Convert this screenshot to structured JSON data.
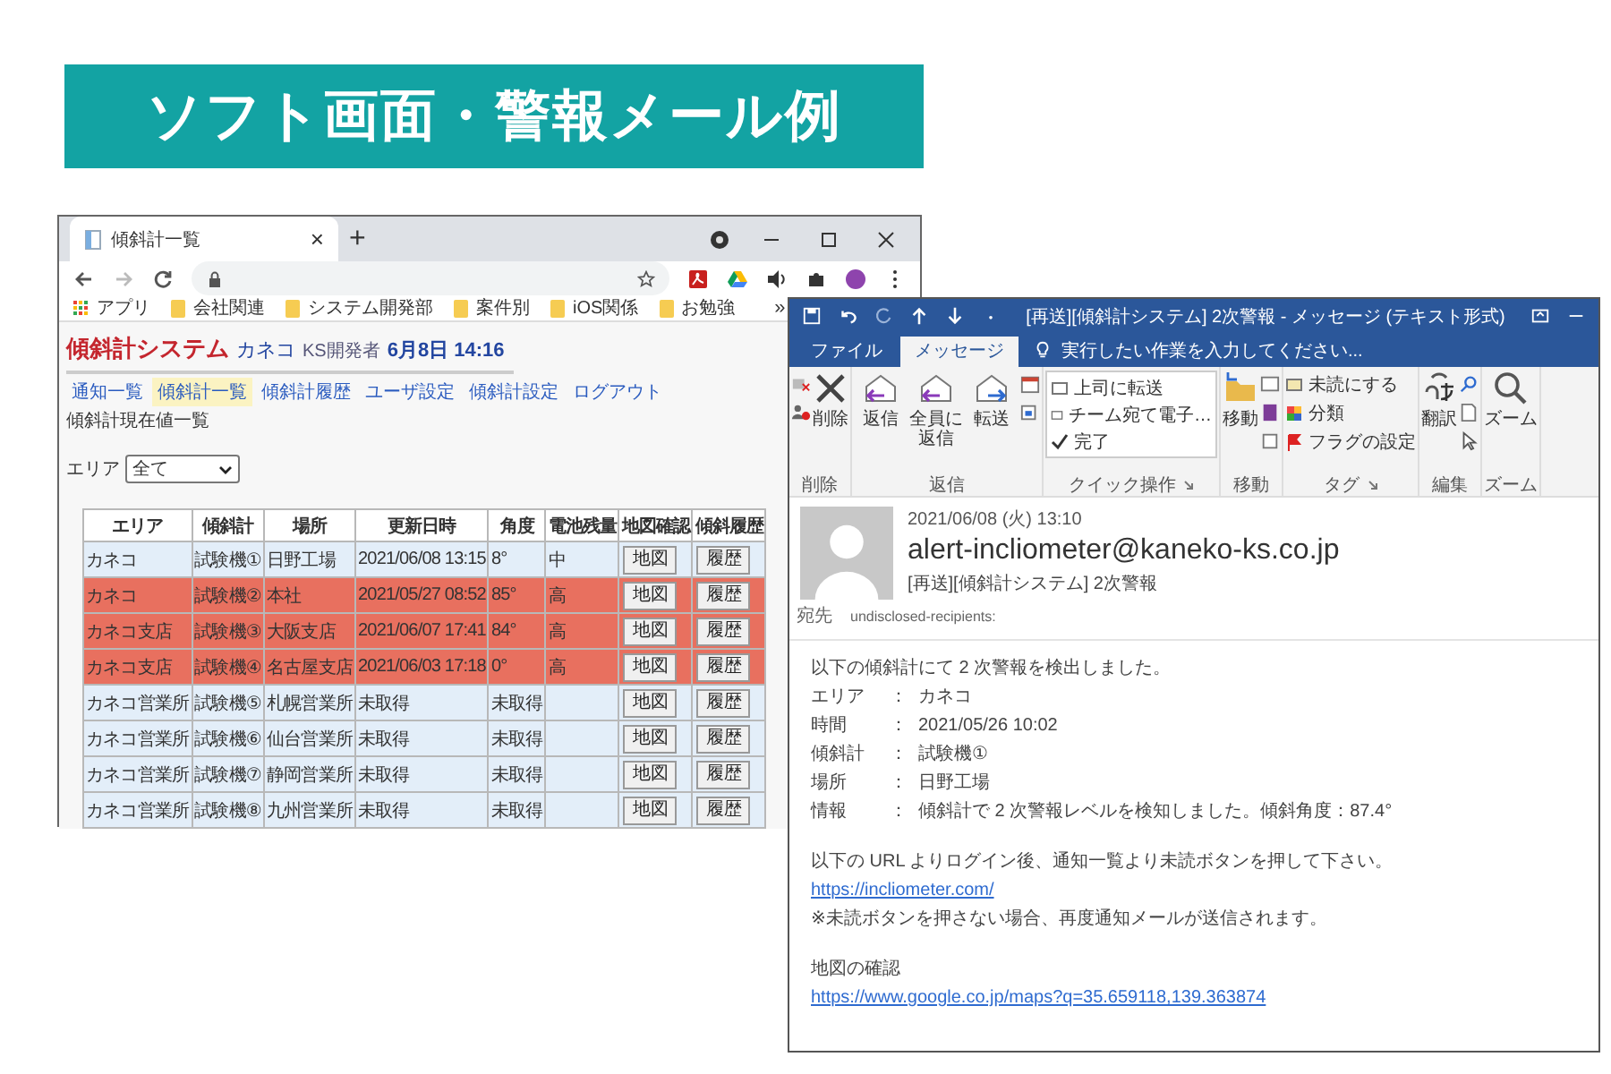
{
  "banner": {
    "title": "ソフト画面・警報メール例"
  },
  "browser": {
    "tab": {
      "title": "傾斜計一覧",
      "close": "×"
    },
    "new_tab": "+",
    "bookmarks": [
      {
        "label": "アプリ",
        "kind": "apps"
      },
      {
        "label": "会社関連",
        "kind": "folder"
      },
      {
        "label": "システム開発部",
        "kind": "folder"
      },
      {
        "label": "案件別",
        "kind": "folder"
      },
      {
        "label": "iOS関係",
        "kind": "folder"
      },
      {
        "label": "お勉強",
        "kind": "folder"
      }
    ],
    "bookmarks_more": "»",
    "app": {
      "title": "傾斜計システム",
      "company": "カネコ",
      "user": "KS開発者",
      "datetime": "6月8日 14:16",
      "nav": [
        {
          "label": "通知一覧",
          "selected": false
        },
        {
          "label": "傾斜計一覧",
          "selected": true
        },
        {
          "label": "傾斜計履歴",
          "selected": false
        },
        {
          "label": "ユーザ設定",
          "selected": false
        },
        {
          "label": "傾斜計設定",
          "selected": false
        },
        {
          "label": "ログアウト",
          "selected": false
        }
      ],
      "page_title": "傾斜計現在値一覧",
      "filter": {
        "label": "エリア",
        "value": "全て"
      },
      "table": {
        "columns": [
          "エリア",
          "傾斜計",
          "場所",
          "更新日時",
          "角度",
          "電池残量",
          "地図確認",
          "傾斜履歴"
        ],
        "rows": [
          {
            "area": "カネコ",
            "meter": "試験機①",
            "place": "日野工場",
            "updated": "2021/06/08 13:15",
            "angle": "8°",
            "battery": "中",
            "map": "地図",
            "history": "履歴",
            "alert": false
          },
          {
            "area": "カネコ",
            "meter": "試験機②",
            "place": "本社",
            "updated": "2021/05/27 08:52",
            "angle": "85°",
            "battery": "高",
            "map": "地図",
            "history": "履歴",
            "alert": true
          },
          {
            "area": "カネコ支店",
            "meter": "試験機③",
            "place": "大阪支店",
            "updated": "2021/06/07 17:41",
            "angle": "84°",
            "battery": "高",
            "map": "地図",
            "history": "履歴",
            "alert": true
          },
          {
            "area": "カネコ支店",
            "meter": "試験機④",
            "place": "名古屋支店",
            "updated": "2021/06/03 17:18",
            "angle": "0°",
            "battery": "高",
            "map": "地図",
            "history": "履歴",
            "alert": true
          },
          {
            "area": "カネコ営業所",
            "meter": "試験機⑤",
            "place": "札幌営業所",
            "updated": "未取得",
            "angle": "未取得",
            "map": "地図",
            "history": "履歴",
            "alert": false
          },
          {
            "area": "カネコ営業所",
            "meter": "試験機⑥",
            "place": "仙台営業所",
            "updated": "未取得",
            "angle": "未取得",
            "map": "地図",
            "history": "履歴",
            "alert": false
          },
          {
            "area": "カネコ営業所",
            "meter": "試験機⑦",
            "place": "静岡営業所",
            "updated": "未取得",
            "angle": "未取得",
            "map": "地図",
            "history": "履歴",
            "alert": false
          },
          {
            "area": "カネコ営業所",
            "meter": "試験機⑧",
            "place": "九州営業所",
            "updated": "未取得",
            "angle": "未取得",
            "map": "地図",
            "history": "履歴",
            "alert": false
          }
        ]
      }
    }
  },
  "mail": {
    "title": "[再送][傾斜計システム] 2次警報 - メッセージ (テキスト形式)",
    "tabs": [
      {
        "label": "ファイル",
        "selected": false
      },
      {
        "label": "メッセージ",
        "selected": true
      }
    ],
    "tell_me": "実行したい作業を入力してください...",
    "ribbon": [
      {
        "kind": "delete",
        "name": "削除",
        "buttons": [
          "削除"
        ]
      },
      {
        "kind": "respond",
        "name": "返信",
        "buttons": [
          "返信",
          "全員に返信",
          "転送"
        ]
      },
      {
        "kind": "quick",
        "name": "クイック操作",
        "items": [
          "上司に転送",
          "チーム宛て電子…",
          "完了"
        ],
        "launcher": true
      },
      {
        "kind": "move",
        "name": "移動",
        "buttons": [
          "移動"
        ]
      },
      {
        "kind": "tags",
        "name": "タグ",
        "items": [
          "未読にする",
          "分類",
          "フラグの設定"
        ],
        "launcher": true
      },
      {
        "kind": "editing",
        "name": "編集",
        "buttons": [
          "翻訳"
        ]
      },
      {
        "kind": "zoom",
        "name": "ズーム",
        "buttons": [
          "ズーム"
        ]
      }
    ],
    "header": {
      "sent": "2021/06/08 (火) 13:10",
      "from": "alert-incliometer@kaneko-ks.co.jp",
      "subject": "[再送][傾斜計システム] 2次警報",
      "to_label": "宛先",
      "to": "undisclosed-recipients:"
    },
    "body": {
      "intro": "以下の傾斜計にて 2 次警報を検出しました。",
      "fields": [
        {
          "label": "エリア",
          "separator": "：",
          "value": "カネコ"
        },
        {
          "label": "時間",
          "separator": "：",
          "value": "2021/05/26 10:02"
        },
        {
          "label": "傾斜計",
          "separator": "：",
          "value": "試験機①"
        },
        {
          "label": "場所",
          "separator": "：",
          "value": "日野工場"
        },
        {
          "label": "情報",
          "separator": "：",
          "value": "傾斜計で 2 次警報レベルを検知しました。傾斜角度：87.4°"
        }
      ],
      "instruction": "以下の URL よりログイン後、通知一覧より未読ボタンを押して下さい。",
      "login_url": "https://incliometer.com/",
      "note": "※未読ボタンを押さない場合、再度通知メールが送信されます。",
      "map_heading": "地図の確認",
      "map_url": "https://www.google.co.jp/maps?q=35.659118,139.363874"
    }
  }
}
